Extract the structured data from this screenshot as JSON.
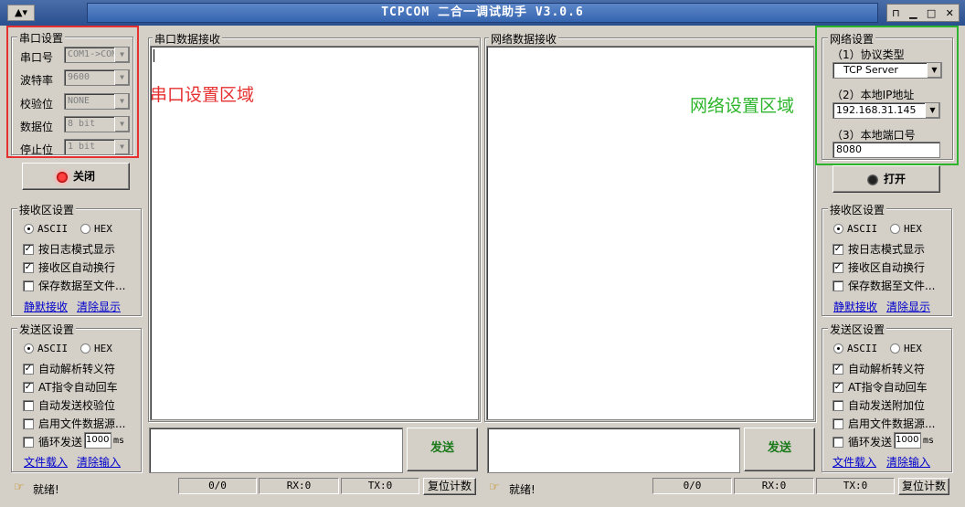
{
  "window": {
    "title": "TCPCOM  二合一调试助手   V3.0.6",
    "icon": "app-icon"
  },
  "serial": {
    "group_title": "串口设置",
    "port_label": "串口号",
    "port_value": "COM1->COM",
    "baud_label": "波特率",
    "baud_value": "9600",
    "parity_label": "校验位",
    "parity_value": "NONE",
    "data_label": "数据位",
    "data_value": "8 bit",
    "stop_label": "停止位",
    "stop_value": "1 bit",
    "close_button": "关闭",
    "annotation": "串口设置区域"
  },
  "serial_receive_settings": {
    "title": "接收区设置",
    "ascii": "ASCII",
    "hex": "HEX",
    "log_mode": "按日志模式显示",
    "auto_wrap": "接收区自动换行",
    "save_file": "保存数据至文件...",
    "silent_receive": "静默接收",
    "clear_display": "清除显示"
  },
  "serial_send_settings": {
    "title": "发送区设置",
    "ascii": "ASCII",
    "hex": "HEX",
    "parse_escape": "自动解析转义符",
    "at_return": "AT指令自动回车",
    "auto_checksum": "自动发送校验位",
    "file_source": "启用文件数据源...",
    "loop_send": "循环发送",
    "loop_value": "1000",
    "loop_unit": "ms",
    "load_file": "文件载入",
    "clear_input": "清除输入"
  },
  "serial_panel": {
    "title": "串口数据接收",
    "send_button": "发送"
  },
  "network_panel": {
    "title": "网络数据接收",
    "send_button": "发送",
    "annotation": "网络设置区域"
  },
  "network": {
    "group_title": "网络设置",
    "protocol_label": "（1）协议类型",
    "protocol_value": "TCP Server",
    "ip_label": "（2）本地IP地址",
    "ip_value": "192.168.31.145",
    "port_label": "（3）本地端口号",
    "port_value": "8080",
    "open_button": "打开"
  },
  "network_receive_settings": {
    "title": "接收区设置",
    "ascii": "ASCII",
    "hex": "HEX",
    "log_mode": "按日志模式显示",
    "auto_wrap": "接收区自动换行",
    "save_file": "保存数据至文件...",
    "silent_receive": "静默接收",
    "clear_display": "清除显示"
  },
  "network_send_settings": {
    "title": "发送区设置",
    "ascii": "ASCII",
    "hex": "HEX",
    "parse_escape": "自动解析转义符",
    "at_return": "AT指令自动回车",
    "auto_append": "自动发送附加位",
    "file_source": "启用文件数据源...",
    "loop_send": "循环发送",
    "loop_value": "1000",
    "loop_unit": "ms",
    "load_file": "文件载入",
    "clear_input": "清除输入"
  },
  "status_left": {
    "ready": "就绪!",
    "count": "0/0",
    "rx": "RX:0",
    "tx": "TX:0",
    "reset": "复位计数"
  },
  "status_right": {
    "ready": "就绪!",
    "count": "0/0",
    "rx": "RX:0",
    "tx": "TX:0",
    "reset": "复位计数"
  },
  "colors": {
    "title_bg": "#2a4f8f",
    "annotation_red": "#e63030",
    "annotation_green": "#2cb52c",
    "link": "#0000cc",
    "send_text": "#1a7a1a"
  }
}
